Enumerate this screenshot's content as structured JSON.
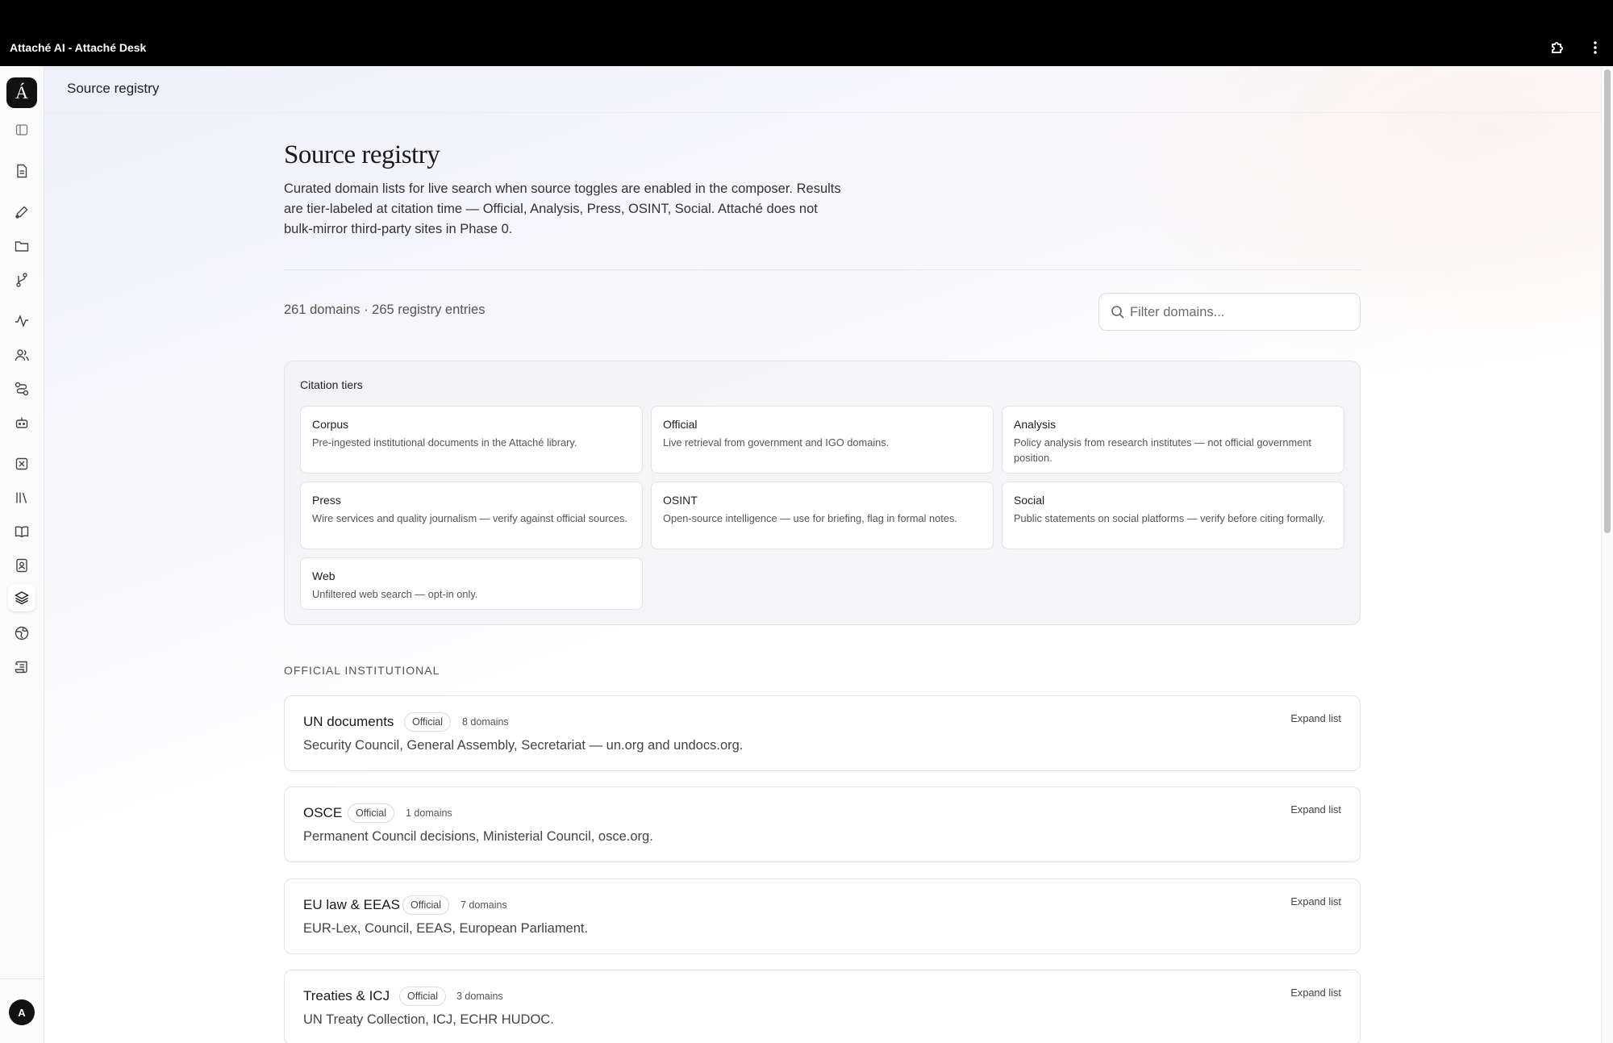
{
  "window": {
    "title": "Attaché AI - Attaché Desk"
  },
  "titlebar": {
    "extensions_icon": "puzzle-icon",
    "menu_icon": "kebab-menu-icon"
  },
  "sidebar": {
    "logo": "Á",
    "items": [
      {
        "name": "panel-toggle-icon",
        "top": 0
      },
      {
        "name": "document-icon"
      },
      {
        "name": "pen-icon"
      },
      {
        "name": "folder-icon"
      },
      {
        "name": "branch-icon"
      },
      {
        "name": "activity-icon"
      },
      {
        "name": "users-icon"
      },
      {
        "name": "route-icon"
      },
      {
        "name": "bot-icon"
      },
      {
        "name": "x-square-icon"
      },
      {
        "name": "library-icon"
      },
      {
        "name": "book-open-icon"
      },
      {
        "name": "contact-book-icon"
      },
      {
        "name": "layers-icon"
      },
      {
        "name": "globe-icon"
      },
      {
        "name": "scroll-icon"
      }
    ],
    "active_item": "layers-icon",
    "avatar_initial": "A"
  },
  "topbar": {
    "breadcrumb": "Source registry"
  },
  "page": {
    "title": "Source registry",
    "description": "Curated domain lists for live search when source toggles are enabled in the composer. Results are tier-labeled at citation time — Official, Analysis, Press, OSINT, Social. Attaché does not bulk-mirror third-party sites in Phase 0.",
    "counts": "261 domains · 265 registry entries",
    "filter_placeholder": "Filter domains..."
  },
  "citation_tiers": {
    "label": "Citation tiers",
    "tiers": [
      {
        "name": "Corpus",
        "desc": "Pre-ingested institutional documents in the Attaché library."
      },
      {
        "name": "Official",
        "desc": "Live retrieval from government and IGO domains."
      },
      {
        "name": "Analysis",
        "desc": "Policy analysis from research institutes — not official government position."
      },
      {
        "name": "Press",
        "desc": "Wire services and quality journalism — verify against official sources."
      },
      {
        "name": "OSINT",
        "desc": "Open-source intelligence — use for briefing, flag in formal notes."
      },
      {
        "name": "Social",
        "desc": "Public statements on social platforms — verify before citing formally."
      },
      {
        "name": "Web",
        "desc": "Unfiltered web search — opt-in only."
      }
    ]
  },
  "section_heading": "OFFICIAL INSTITUTIONAL",
  "registry": [
    {
      "name": "UN documents",
      "tier": "Official",
      "count": "8 domains",
      "desc": "Security Council, General Assembly, Secretariat — un.org and undocs.org.",
      "action": "Expand list"
    },
    {
      "name": "OSCE",
      "tier": "Official",
      "count": "1 domains",
      "desc": "Permanent Council decisions, Ministerial Council, osce.org.",
      "action": "Expand list"
    },
    {
      "name": "EU law & EEAS",
      "tier": "Official",
      "count": "7 domains",
      "desc": "EUR-Lex, Council, EEAS, European Parliament.",
      "action": "Expand list"
    },
    {
      "name": "Treaties & ICJ",
      "tier": "Official",
      "count": "3 domains",
      "desc": "UN Treaty Collection, ICJ, ECHR HUDOC.",
      "action": "Expand list"
    }
  ]
}
